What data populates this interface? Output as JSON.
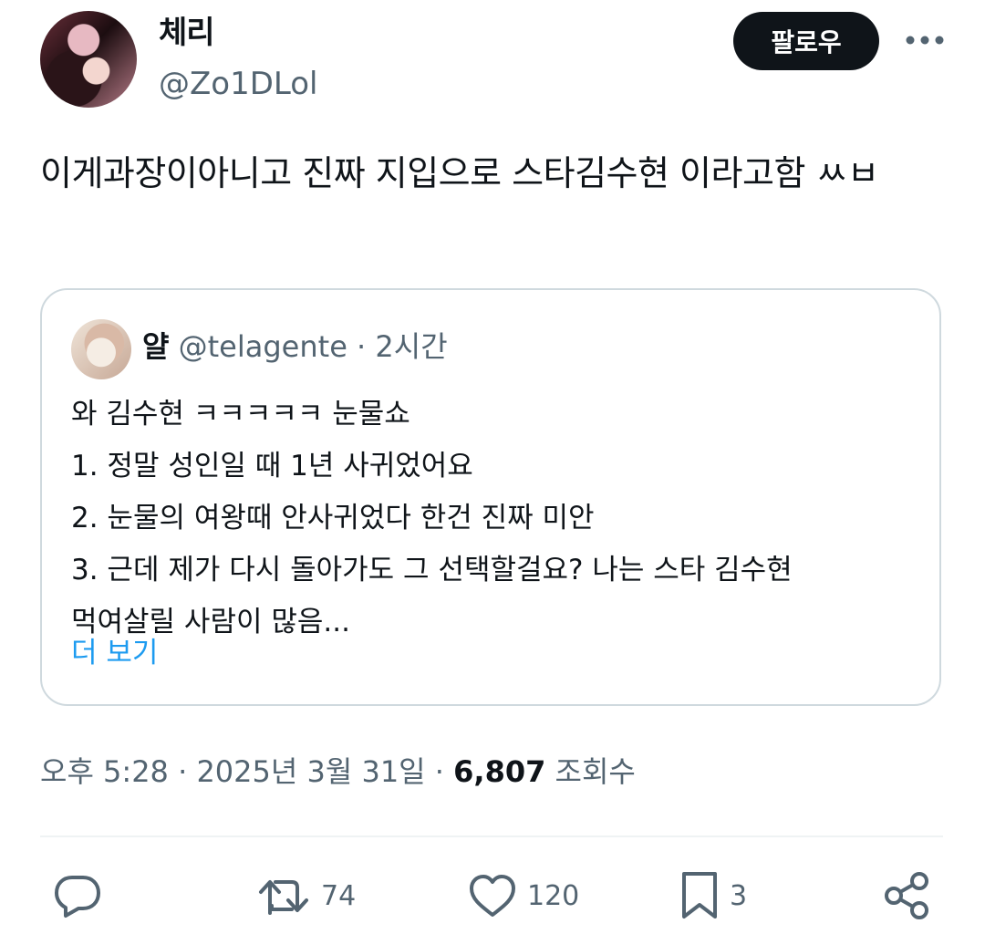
{
  "author": {
    "name": "체리",
    "handle": "@Zo1DLol"
  },
  "header": {
    "follow_label": "팔로우"
  },
  "tweet": {
    "text": "이게과장이아니고 진짜 지입으로 스타김수현 이라고함 ㅆㅂ"
  },
  "quote": {
    "name": "얄",
    "handle": "@telagente",
    "separator": "·",
    "time": "2시간",
    "lines": [
      "와 김수현 ㅋㅋㅋㅋㅋ 눈물쇼",
      "1. 정말 성인일 때 1년 사귀었어요",
      "2. 눈물의 여왕때 안사귀었다 한건 진짜 미안",
      "3. 근데 제가 다시 돌아가도 그 선택할걸요? 나는 스타 김수현",
      "먹여살릴 사람이 많음..."
    ],
    "more_label": "더 보기"
  },
  "meta": {
    "time": "오후 5:28",
    "separator": "·",
    "date": "2025년 3월 31일",
    "views_count": "6,807",
    "views_label": "조회수"
  },
  "actions": {
    "reply_count": "",
    "retweet_count": "74",
    "like_count": "120",
    "bookmark_count": "3"
  },
  "icons": [
    "more-icon",
    "reply-icon",
    "retweet-icon",
    "like-icon",
    "bookmark-icon",
    "share-icon"
  ],
  "colors": {
    "text": "#0f1419",
    "secondary": "#536471",
    "link": "#1d9bf0",
    "border": "#cfd9de",
    "button_bg": "#0f1419"
  }
}
